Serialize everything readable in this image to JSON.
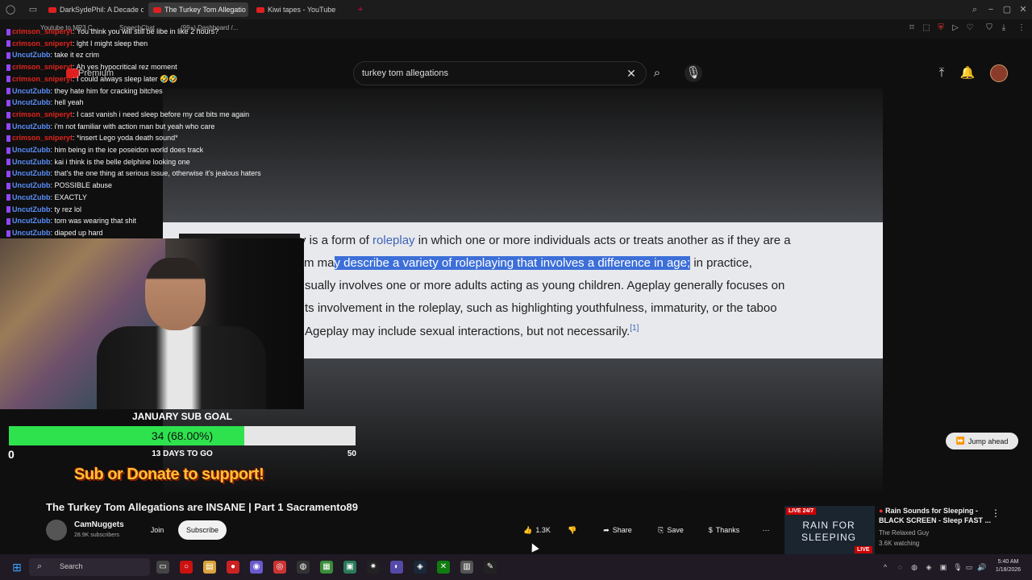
{
  "browser": {
    "tabs": [
      {
        "label": "DarkSydePhil: A Decade o",
        "active": false
      },
      {
        "label": "The Turkey Tom Allegatio",
        "active": true
      },
      {
        "label": "Kiwi tapes - YouTube",
        "active": false
      }
    ],
    "new_tab": "+",
    "bookmarks": [
      "Youtube to MP3 C...",
      "SpeechChat",
      "(99+) Dashboard /..."
    ]
  },
  "youtube": {
    "logo": "Premium",
    "search_value": "turkey tom allegations"
  },
  "chat": [
    {
      "user": "crimson_sniperyt",
      "color": "red",
      "msg": "You think you will still be libe in like 2 hours?"
    },
    {
      "user": "crimson_sniperyt",
      "color": "red",
      "msg": "lght I might sleep then"
    },
    {
      "user": "UncutZubb",
      "color": "blue",
      "msg": "take it ez crim"
    },
    {
      "user": "crimson_sniperyt",
      "color": "red",
      "msg": "Ah yes hypocritical rez moment"
    },
    {
      "user": "crimson_sniperyt",
      "color": "red",
      "msg": "I could always sleep later 🤣🤣"
    },
    {
      "user": "UncutZubb",
      "color": "blue",
      "msg": "they hate him for cracking bitches"
    },
    {
      "user": "UncutZubb",
      "color": "blue",
      "msg": "hell yeah"
    },
    {
      "user": "crimson_sniperyt",
      "color": "red",
      "msg": "I cast vanish i need sleep before my cat bits me again"
    },
    {
      "user": "UncutZubb",
      "color": "blue",
      "msg": "i'm not familiar with action man but yeah who care"
    },
    {
      "user": "crimson_sniperyt",
      "color": "red",
      "msg": "*insert Lego yoda death sound*"
    },
    {
      "user": "UncutZubb",
      "color": "blue",
      "msg": "him being in the ice poseidon world does track"
    },
    {
      "user": "UncutZubb",
      "color": "blue",
      "msg": "kai i think is the belle delphine looking one"
    },
    {
      "user": "UncutZubb",
      "color": "blue",
      "msg": "that's the one thing at serious issue, otherwise it's jealous haters"
    },
    {
      "user": "UncutZubb",
      "color": "blue",
      "msg": "POSSIBLE abuse"
    },
    {
      "user": "UncutZubb",
      "color": "blue",
      "msg": "EXACTLY"
    },
    {
      "user": "UncutZubb",
      "color": "blue",
      "msg": "ty rez lol"
    },
    {
      "user": "UncutZubb",
      "color": "blue",
      "msg": "tom was wearing that shit"
    },
    {
      "user": "UncutZubb",
      "color": "blue",
      "msg": "diaped up hard"
    }
  ],
  "article": {
    "line1_a": "y is a form of ",
    "line1_link": "roleplay",
    "line1_b": " in which one or more individuals acts or treats another as if they are a",
    "line2_a": "rm ma",
    "line2_hl": "y describe a variety of roleplaying that involves a difference in age;",
    "line2_b": " in practice,",
    "line3": "sually involves one or more adults acting as young children. Ageplay generally focuses on",
    "line4": "ts involvement in the roleplay, such as highlighting youthfulness, immaturity, or the taboo",
    "line5": "Ageplay may include sexual interactions, but not necessarily.",
    "footnote": "[1]"
  },
  "jump_ahead": "Jump ahead",
  "sub_goal": {
    "title": "JANUARY SUB GOAL",
    "progress_text": "34 (68.00%)",
    "fraction": 0.68,
    "min": "0",
    "max": "50",
    "days_left": "13 DAYS TO GO",
    "support_text": "Sub or Donate to support!"
  },
  "video": {
    "title": "The Turkey Tom Allegations are INSANE | Part 1 Sacramento89",
    "channel": "CamNuggets",
    "subscribers": "28.9K subscribers",
    "join": "Join",
    "subscribe": "Subscribe",
    "likes": "1.3K",
    "share": "Share",
    "save": "Save",
    "thanks": "Thanks"
  },
  "related": {
    "live_label": "LIVE",
    "live_247": "LIVE 24/7",
    "thumb_text": "RAIN FOR SLEEPING",
    "title": "Rain Sounds for Sleeping - BLACK SCREEN - Sleep FAST ...",
    "channel": "The Relaxed Guy",
    "watching": "3.6K watching"
  },
  "taskbar": {
    "search_label": "Search",
    "time": "5:40 AM",
    "date": "1/18/2026"
  },
  "colors": {
    "goal_fill": "#2ee24e",
    "highlight": "#3d6fd8",
    "chat_red": "#e2241e",
    "chat_blue": "#5b8ff9"
  }
}
